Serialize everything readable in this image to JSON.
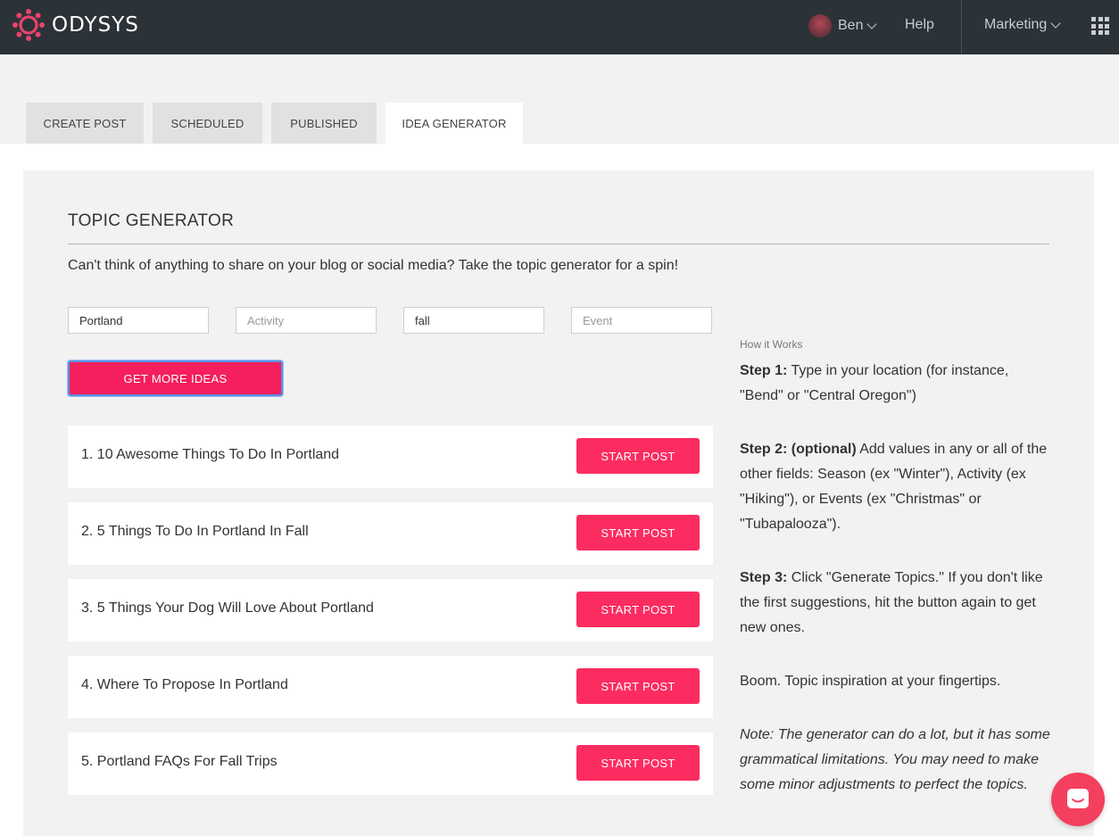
{
  "header": {
    "brand": "ODYSYS",
    "user_name": "Ben",
    "help": "Help",
    "account": "Marketing",
    "logo_color": "#e8436d"
  },
  "tabs": [
    {
      "label": "CREATE POST",
      "active": false
    },
    {
      "label": "SCHEDULED",
      "active": false
    },
    {
      "label": "PUBLISHED",
      "active": false
    },
    {
      "label": "IDEA GENERATOR",
      "active": true
    }
  ],
  "generator": {
    "title": "TOPIC GENERATOR",
    "intro": "Can't think of anything to share on your blog or social media? Take the topic generator for a spin!",
    "fields": [
      {
        "value": "Portland",
        "placeholder": ""
      },
      {
        "value": "",
        "placeholder": "Activity"
      },
      {
        "value": "fall",
        "placeholder": ""
      },
      {
        "value": "",
        "placeholder": "Event"
      }
    ],
    "button": "GET MORE IDEAS",
    "accent": "#f41f5c"
  },
  "results": [
    {
      "label": "1. 10 Awesome Things To Do In Portland",
      "action": "START POST"
    },
    {
      "label": "2. 5 Things To Do In Portland In Fall",
      "action": "START POST"
    },
    {
      "label": "3. 5 Things Your Dog Will Love About Portland",
      "action": "START POST"
    },
    {
      "label": "4. Where To Propose In Portland",
      "action": "START POST"
    },
    {
      "label": "5. Portland FAQs For Fall Trips",
      "action": "START POST"
    }
  ],
  "how_it_works": {
    "title": "How it Works",
    "step1_label": "Step 1:",
    "step1_text": " Type in your location (for instance, \"Bend\" or \"Central Oregon\")",
    "step2_label": "Step 2: (optional)",
    "step2_text": " Add values in any or all of the other fields: Season (ex \"Winter\"), Activity (ex \"Hiking\"), or Events (ex \"Christmas\" or \"Tubapalooza\").",
    "step3_label": "Step 3:",
    "step3_text": " Click \"Generate Topics.\" If you don't like the first suggestions, hit the button again to get new ones.",
    "boom": "Boom. Topic inspiration at your fingertips.",
    "note": "Note: The generator can do a lot, but it has some grammatical limitations. You may need to make some minor adjustments to perfect the topics."
  },
  "icons": {
    "logo": "odysys-logo-icon",
    "avatar": "user-avatar",
    "caret": "chevron-down-icon",
    "apps": "apps-grid-icon",
    "chat": "chat-icon"
  }
}
